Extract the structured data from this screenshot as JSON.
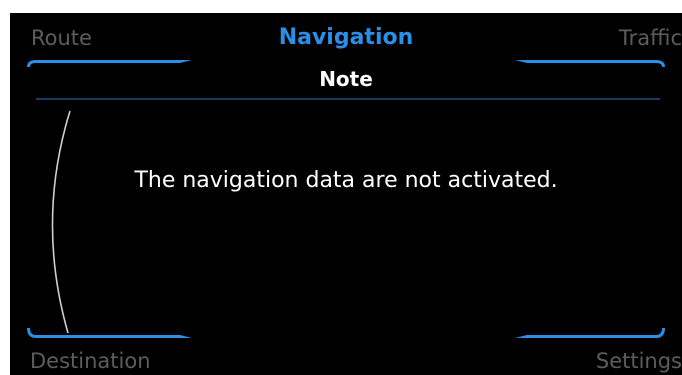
{
  "header": {
    "left_tab": "Route",
    "title": "Navigation",
    "right_tab": "Traffic"
  },
  "dialog": {
    "title": "Note",
    "message": "The navigation data are not activated."
  },
  "footer": {
    "left_key": "Destination",
    "right_key": "Settings"
  },
  "colors": {
    "accent": "#2b8fe8",
    "background": "#000000",
    "inactive_text": "#5d5d5d",
    "text": "#ffffff"
  }
}
